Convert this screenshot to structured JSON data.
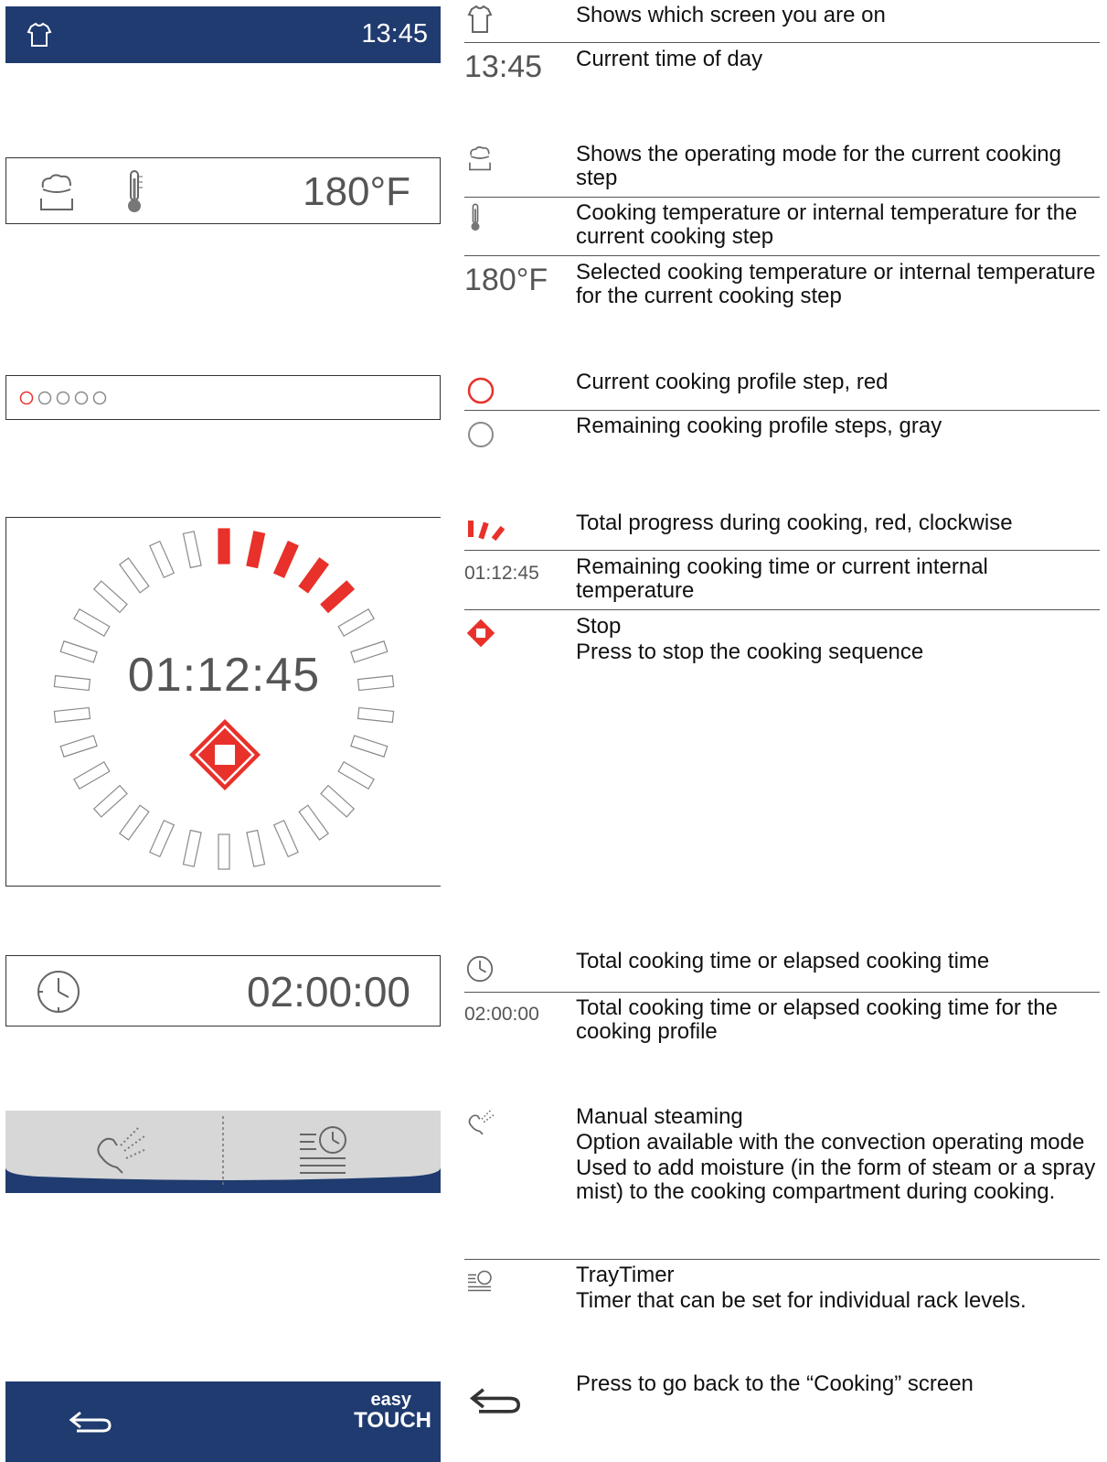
{
  "colors": {
    "bar_blue": "#1f3b6f",
    "accent_red": "#e8312a",
    "gray": "#8a8a8a"
  },
  "screens": {
    "header": {
      "time": "13:45",
      "icon": "chef-jacket-icon"
    },
    "mode_bar": {
      "temperature": "180°F",
      "mode_icon": "steam-pot-icon",
      "temp_icon": "thermometer-icon"
    },
    "steps_bar": {
      "total_steps": 5,
      "current_step": 1
    },
    "progress": {
      "remaining": "01:12:45",
      "progress_fraction": 0.17,
      "segments": 30,
      "red_segments": 5
    },
    "time_bar": {
      "total_time": "02:00:00",
      "icon": "clock-icon"
    },
    "action_bar": {
      "left_icon": "manual-steaming-icon",
      "right_icon": "traytimer-icon"
    },
    "footer": {
      "back_icon": "back-arrow-icon",
      "logo_top": "easy",
      "logo_bottom": "TOUCH"
    }
  },
  "legend": {
    "header_icon_desc": "Shows which screen you are on",
    "time_sample": "13:45",
    "time_desc": "Current time of day",
    "mode_desc": "Shows the operating mode for the current cooking step",
    "thermo_desc": "Cooking temperature or internal temperature for the current cooking step",
    "temp_sample": "180°F",
    "temp_desc": "Selected cooking temperature or internal temperature for the current cooking step",
    "step_current_desc": "Current cooking profile step, red",
    "step_remaining_desc": "Remaining cooking profile steps, gray",
    "progress_desc": "Total progress during cooking, red, clockwise",
    "remaining_sample": "01:12:45",
    "remaining_desc": "Remaining cooking time or current internal temperature",
    "stop_title": "Stop",
    "stop_desc": "Press to stop the cooking sequence",
    "clock_desc": "Total cooking time or elapsed cooking time",
    "total_sample": "02:00:00",
    "total_desc": "Total cooking time or elapsed cooking time for the cooking profile",
    "steam_title": "Manual steaming",
    "steam_line2": "Option available with the convection operating mode",
    "steam_line3": "Used to add moisture (in the form of steam or a spray mist) to the cooking compartment during cooking.",
    "tray_title": "TrayTimer",
    "tray_desc": "Timer that can be set for individual rack levels.",
    "back_desc": "Press to go back to the “Cooking” screen"
  }
}
